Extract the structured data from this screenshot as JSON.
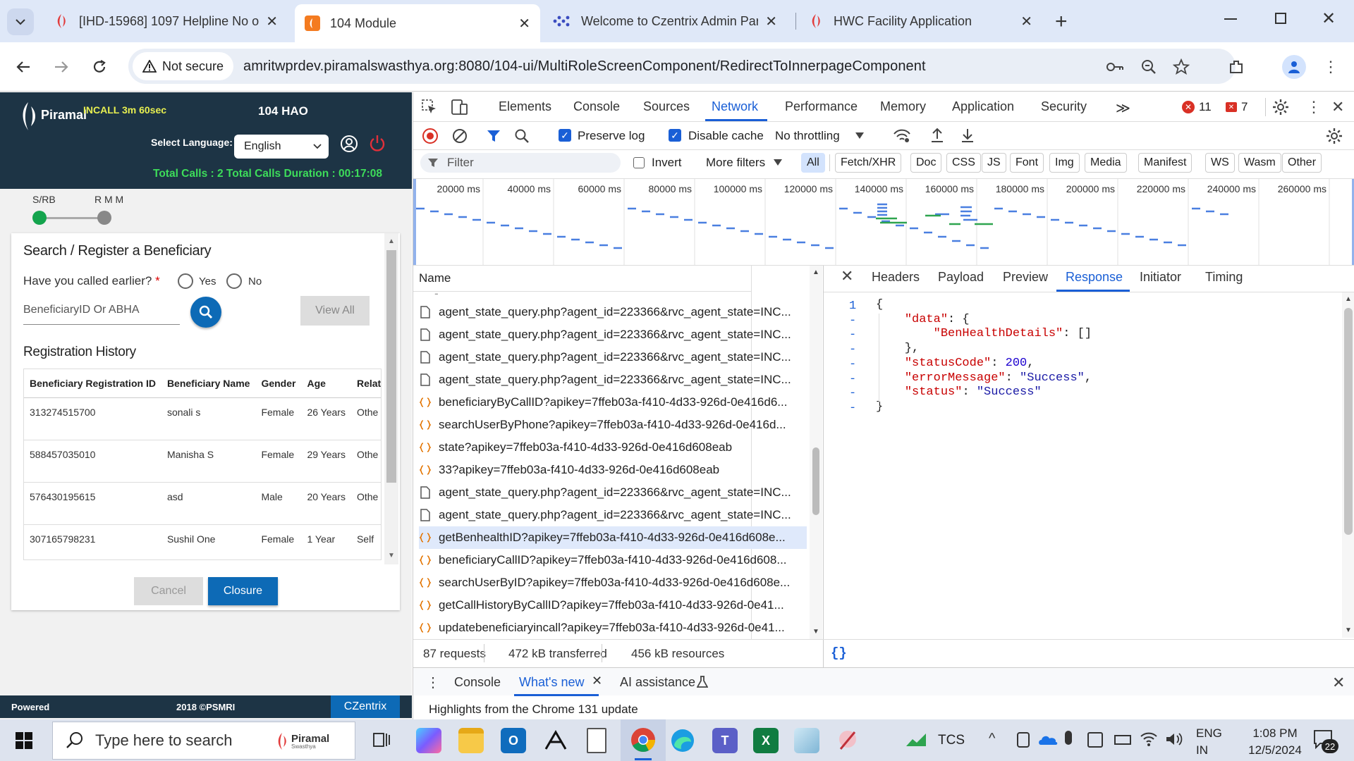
{
  "browser": {
    "tabs": [
      {
        "title": "[IHD-15968] 1097 Helpline No o",
        "active": false
      },
      {
        "title": "104 Module",
        "active": true
      },
      {
        "title": "Welcome to Czentrix Admin Par",
        "active": false
      },
      {
        "title": "HWC Facility Application",
        "active": false
      }
    ],
    "security_label": "Not secure",
    "url": "amritwprdev.piramalswasthya.org:8080/104-ui/MultiRoleScreenComponent/RedirectToInnerpageComponent"
  },
  "app": {
    "brand": "Piramal",
    "call_status": "INCALL 3m 60sec",
    "role": "104 HAO",
    "language_label": "Select Language:",
    "language_value": "English",
    "totals": "Total Calls : 2 Total Calls Duration : 00:17:08",
    "steps": [
      "S/RB",
      "R M M"
    ],
    "card_title": "Search / Register a Beneficiary",
    "called_earlier_label": "Have you called earlier?",
    "required_mark": "*",
    "yes_label": "Yes",
    "no_label": "No",
    "search_placeholder": "BeneficiaryID Or ABHA",
    "view_all_label": "View All",
    "history_title": "Registration History",
    "history_columns": [
      "Beneficiary Registration ID",
      "Beneficiary Name",
      "Gender",
      "Age",
      "Relat"
    ],
    "history_rows": [
      [
        "313274515700",
        "sonali s",
        "Female",
        "26 Years",
        "Othe"
      ],
      [
        "588457035010",
        "Manisha S",
        "Female",
        "29 Years",
        "Othe"
      ],
      [
        "576430195615",
        "asd",
        "Male",
        "20 Years",
        "Othe"
      ],
      [
        "307165798231",
        "Sushil One",
        "Female",
        "1 Year",
        "Self"
      ]
    ],
    "cancel_label": "Cancel",
    "closure_label": "Closure",
    "footer": {
      "powered": "Powered",
      "copyright": "2018 ©PSMRI",
      "vendor": "CZentrix"
    }
  },
  "devtools": {
    "tabs": [
      "Elements",
      "Console",
      "Sources",
      "Network",
      "Performance",
      "Memory",
      "Application",
      "Security"
    ],
    "active_tab": "Network",
    "error_count": "11",
    "warning_count": "7",
    "preserve_log_label": "Preserve log",
    "disable_cache_label": "Disable cache",
    "throttling": "No throttling",
    "filter_placeholder": "Filter",
    "invert_label": "Invert",
    "more_filters_label": "More filters",
    "type_filters": [
      "All",
      "Fetch/XHR",
      "Doc",
      "CSS",
      "JS",
      "Font",
      "Img",
      "Media",
      "Manifest",
      "WS",
      "Wasm",
      "Other"
    ],
    "timeline_ticks": [
      "20000 ms",
      "40000 ms",
      "60000 ms",
      "80000 ms",
      "100000 ms",
      "120000 ms",
      "140000 ms",
      "160000 ms",
      "180000 ms",
      "200000 ms",
      "220000 ms",
      "240000 ms",
      "260000 ms"
    ],
    "name_header": "Name",
    "requests": [
      {
        "name": "agent_state_query.php?agent_id=223366&rvc_agent_state=INC...",
        "kind": "doc"
      },
      {
        "name": "agent_state_query.php?agent_id=223366&rvc_agent_state=INC...",
        "kind": "doc"
      },
      {
        "name": "agent_state_query.php?agent_id=223366&rvc_agent_state=INC...",
        "kind": "doc"
      },
      {
        "name": "agent_state_query.php?agent_id=223366&rvc_agent_state=INC...",
        "kind": "doc"
      },
      {
        "name": "beneficiaryByCallID?apikey=7ffeb03a-f410-4d33-926d-0e416d6...",
        "kind": "xhr"
      },
      {
        "name": "searchUserByPhone?apikey=7ffeb03a-f410-4d33-926d-0e416d...",
        "kind": "xhr"
      },
      {
        "name": "state?apikey=7ffeb03a-f410-4d33-926d-0e416d608eab",
        "kind": "xhr"
      },
      {
        "name": "33?apikey=7ffeb03a-f410-4d33-926d-0e416d608eab",
        "kind": "xhr"
      },
      {
        "name": "agent_state_query.php?agent_id=223366&rvc_agent_state=INC...",
        "kind": "doc"
      },
      {
        "name": "agent_state_query.php?agent_id=223366&rvc_agent_state=INC...",
        "kind": "doc"
      },
      {
        "name": "getBenhealthID?apikey=7ffeb03a-f410-4d33-926d-0e416d608e...",
        "kind": "xhr",
        "selected": true
      },
      {
        "name": "beneficiaryCallID?apikey=7ffeb03a-f410-4d33-926d-0e416d608...",
        "kind": "xhr"
      },
      {
        "name": "searchUserByID?apikey=7ffeb03a-f410-4d33-926d-0e416d608e...",
        "kind": "xhr"
      },
      {
        "name": "getCallHistoryByCallID?apikey=7ffeb03a-f410-4d33-926d-0e41...",
        "kind": "xhr"
      },
      {
        "name": "updatebeneficiaryincall?apikey=7ffeb03a-f410-4d33-926d-0e41...",
        "kind": "xhr"
      }
    ],
    "detail_tabs": [
      "Headers",
      "Payload",
      "Preview",
      "Response",
      "Initiator",
      "Timing"
    ],
    "active_detail_tab": "Response",
    "response_gutter": [
      "1",
      "-",
      "-",
      "-",
      "-",
      "-",
      "-",
      "-"
    ],
    "response_lines": [
      "{",
      "    \"data\": {",
      "        \"BenHealthDetails\": []",
      "    },",
      "    \"statusCode\": 200,",
      "    \"errorMessage\": \"Success\",",
      "    \"status\": \"Success\"",
      "}"
    ],
    "summary": {
      "requests": "87 requests",
      "transferred": "472 kB transferred",
      "resources": "456 kB resources"
    },
    "pretty_print": "{}",
    "drawer_tabs": [
      "Console",
      "What's new",
      "AI assistance"
    ],
    "drawer_active": "What's new",
    "drawer_text": "Highlights from the Chrome 131 update"
  },
  "taskbar": {
    "search_placeholder": "Type here to search",
    "search_brand": "Piramal",
    "search_brand_sub": "Swasthya",
    "tcs_label": "TCS",
    "lang": "ENG",
    "region": "IN",
    "time": "1:08 PM",
    "date": "12/5/2024",
    "notifications": "22"
  },
  "colors": {
    "accent": "#1a5fd6",
    "app_header": "#1d3445",
    "green": "#2ea44f",
    "closure": "#0d6ab6"
  }
}
